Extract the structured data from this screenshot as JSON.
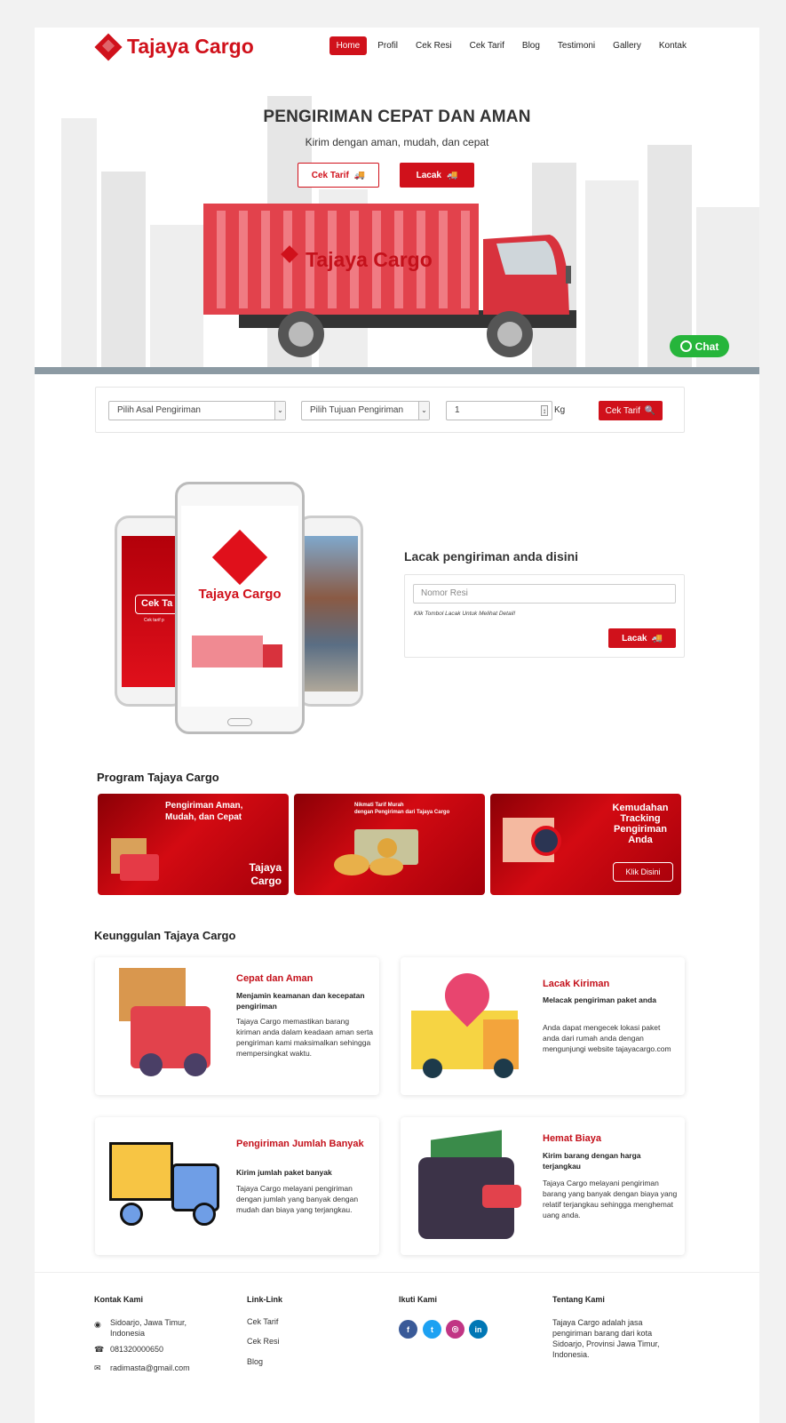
{
  "brand": {
    "name": "Tajaya Cargo",
    "color": "#d0111b"
  },
  "nav": {
    "items": [
      "Home",
      "Profil",
      "Cek Resi",
      "Cek Tarif",
      "Blog",
      "Testimoni",
      "Gallery",
      "Kontak"
    ],
    "active": "Home"
  },
  "hero": {
    "title": "PENGIRIMAN CEPAT DAN AMAN",
    "subtitle": "Kirim dengan aman, mudah, dan cepat",
    "btn_tarif": "Cek Tarif",
    "btn_lacak": "Lacak",
    "truck_label": "Tajaya Cargo"
  },
  "chat": {
    "label": "Chat"
  },
  "tarif_form": {
    "origin_placeholder": "Pilih Asal Pengiriman",
    "dest_placeholder": "Pilih Tujuan Pengiriman",
    "weight_value": "1",
    "unit": "Kg",
    "button": "Cek Tarif"
  },
  "phones": {
    "brand": "Tajaya Cargo",
    "left_button": "Cek Ta",
    "left_small": "Cek tarif p"
  },
  "track": {
    "title": "Lacak pengiriman anda disini",
    "placeholder": "Nomor Resi",
    "hint": "Klik Tombol Lacak Untuk Melihat Detail!",
    "button": "Lacak"
  },
  "program": {
    "title": "Program Tajaya Cargo",
    "banner1_text": "Pengiriman Aman, Mudah, dan Cepat",
    "banner1_brand_line1": "Tajaya",
    "banner1_brand_line2": "Cargo",
    "banner2_text_line1": "Nikmati Tarif Murah",
    "banner2_text_line2": "dengan Pengiriman dari Tajaya Cargo",
    "banner3_text": "Kemudahan Tracking Pengiriman Anda",
    "banner3_button": "Klik Disini"
  },
  "features": {
    "title": "Keunggulan Tajaya Cargo",
    "items": [
      {
        "title": "Cepat dan Aman",
        "subtitle": "Menjamin keamanan dan kecepatan pengiriman",
        "desc": "Tajaya Cargo memastikan barang kiriman anda dalam keadaan aman serta pengiriman kami maksimalkan sehingga mempersingkat waktu."
      },
      {
        "title": "Lacak Kiriman",
        "subtitle": "Melacak pengiriman paket anda",
        "desc": "Anda dapat mengecek lokasi paket anda dari rumah anda dengan mengunjungi website tajayacargo.com"
      },
      {
        "title": "Pengiriman Jumlah Banyak",
        "subtitle": "Kirim jumlah paket banyak",
        "desc": "Tajaya Cargo melayani pengiriman dengan jumlah yang banyak dengan mudah dan biaya yang terjangkau."
      },
      {
        "title": "Hemat Biaya",
        "subtitle": "Kirim barang dengan harga terjangkau",
        "desc": "Tajaya Cargo melayani pengiriman barang yang banyak dengan biaya yang relatif terjangkau sehingga menghemat uang anda."
      }
    ]
  },
  "footer": {
    "contact": {
      "title": "Kontak Kami",
      "address": "Sidoarjo, Jawa Timur, Indonesia",
      "phone": "081320000650",
      "email": "radimasta@gmail.com"
    },
    "links": {
      "title": "Link-Link",
      "items": [
        "Cek Tarif",
        "Cek Resi",
        "Blog"
      ]
    },
    "social": {
      "title": "Ikuti Kami",
      "items": [
        "facebook-icon",
        "twitter-icon",
        "instagram-icon",
        "linkedin-icon"
      ]
    },
    "about": {
      "title": "Tentang Kami",
      "text": "Tajaya Cargo adalah jasa pengiriman barang dari kota Sidoarjo, Provinsi Jawa Timur, Indonesia."
    }
  }
}
